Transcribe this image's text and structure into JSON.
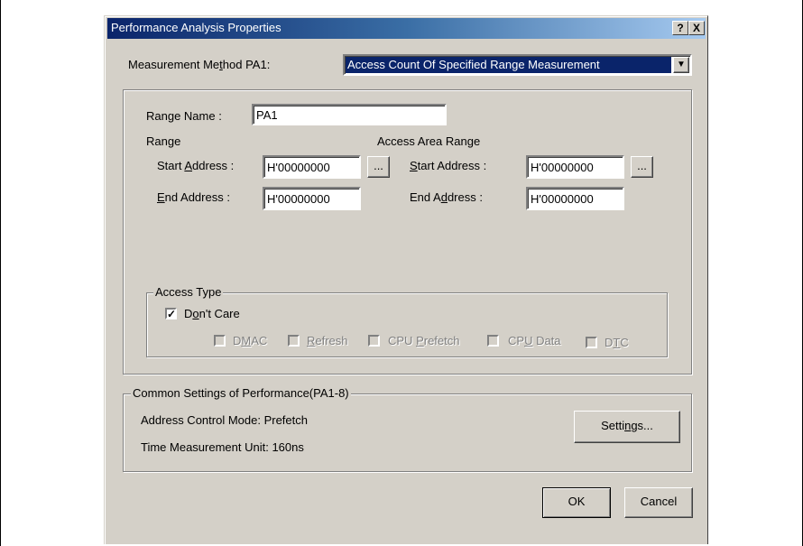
{
  "window": {
    "title": "Performance Analysis Properties",
    "help_btn": "?",
    "close_btn": "X"
  },
  "measurement": {
    "label_pre": "Measurement Me",
    "label_ul": "t",
    "label_post": "hod PA1:",
    "selected": "Access Count Of Specified Range Measurement"
  },
  "range_name": {
    "label": "Range Name :",
    "value": "PA1"
  },
  "range": {
    "header": "Range",
    "start_pre": "Start ",
    "start_ul": "A",
    "start_post": "ddress :",
    "start_value": "H'00000000",
    "end_ul": "E",
    "end_post": "nd Address :",
    "end_value": "H'00000000",
    "browse": "..."
  },
  "access_area": {
    "header": "Access Area Range",
    "start_ul": "S",
    "start_post": "tart Address :",
    "start_value": "H'00000000",
    "end_pre": "End A",
    "end_ul": "d",
    "end_post": "dress :",
    "end_value": "H'00000000",
    "browse": "..."
  },
  "access_type": {
    "legend": "Access Type",
    "dont_care_pre": "D",
    "dont_care_ul": "o",
    "dont_care_post": "n't Care",
    "dont_care_checked": true,
    "dmac_pre": "D",
    "dmac_ul": "M",
    "dmac_post": "AC",
    "refresh_ul": "R",
    "refresh_post": "efresh",
    "cpu_prefetch_pre": "CPU ",
    "cpu_prefetch_ul": "P",
    "cpu_prefetch_post": "refetch",
    "cpu_data_pre": "CP",
    "cpu_data_ul": "U",
    "cpu_data_post": " Data",
    "dtc_pre": "D",
    "dtc_ul": "T",
    "dtc_post": "C"
  },
  "common": {
    "legend": "Common Settings of Performance(PA1-8)",
    "address_mode": "Address Control Mode: Prefetch",
    "time_unit": "Time Measurement Unit: 160ns",
    "settings_pre": "Setti",
    "settings_ul": "n",
    "settings_post": "gs..."
  },
  "buttons": {
    "ok": "OK",
    "cancel": "Cancel"
  }
}
